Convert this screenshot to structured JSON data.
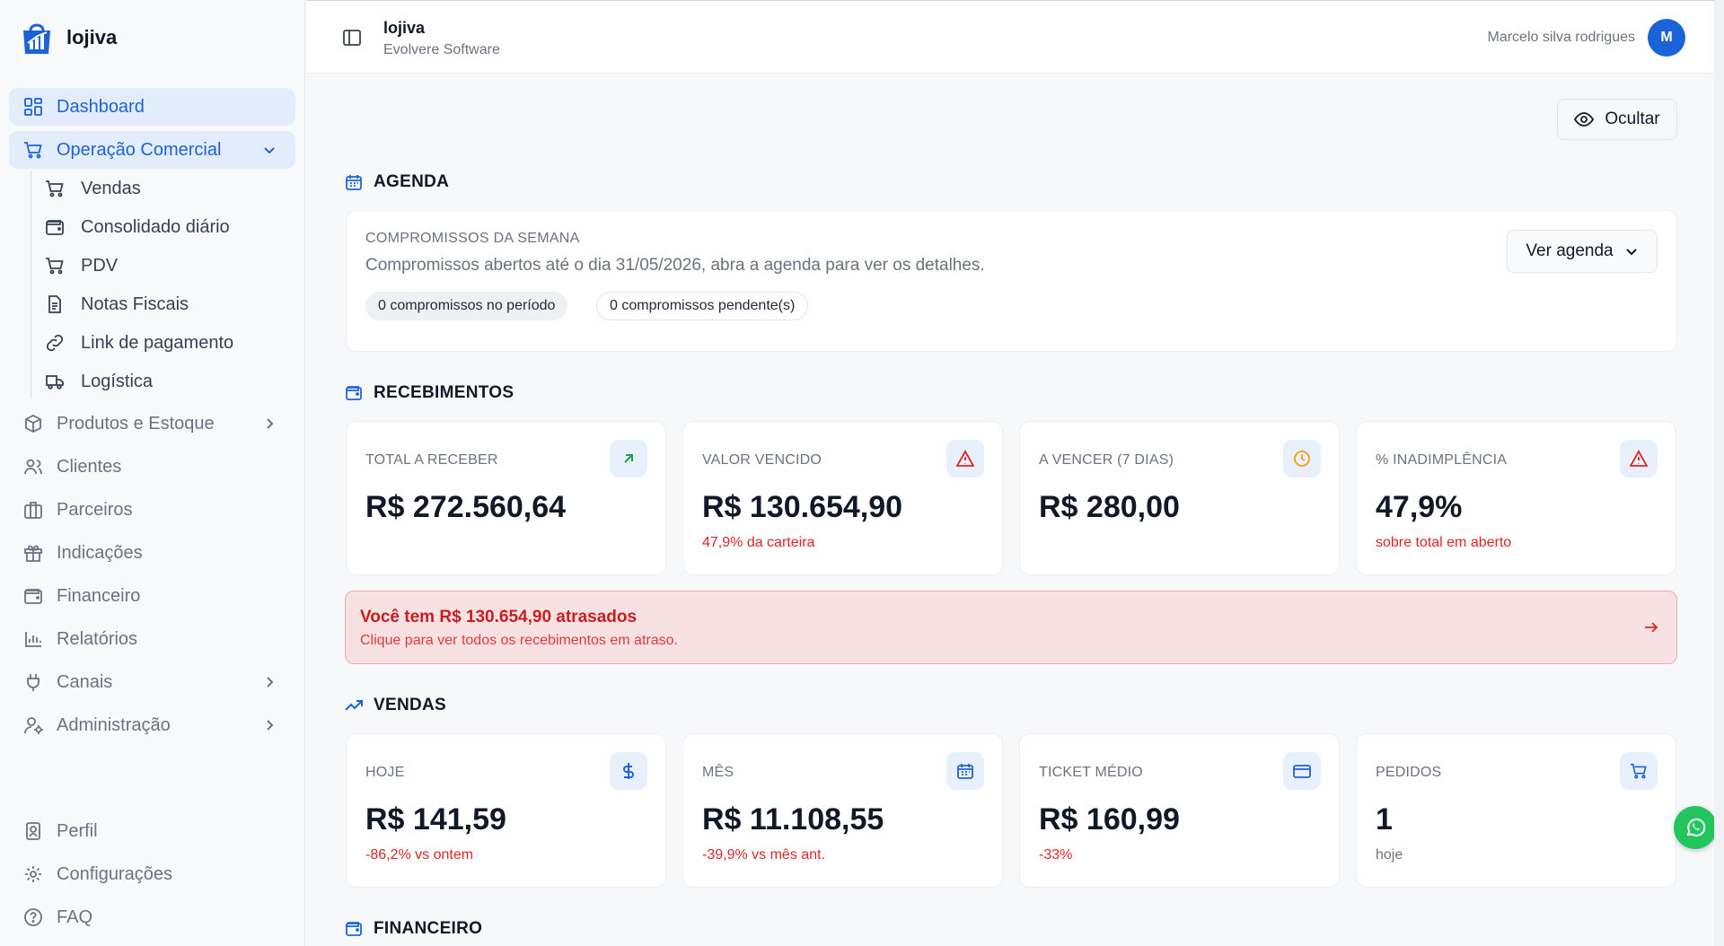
{
  "app": {
    "name": "lojiva"
  },
  "sidebar": {
    "items": [
      {
        "label": "Dashboard",
        "icon": "dashboard-icon"
      },
      {
        "label": "Operação Comercial",
        "icon": "cart-icon"
      },
      {
        "label": "Produtos e Estoque",
        "icon": "box-icon"
      },
      {
        "label": "Clientes",
        "icon": "users-icon"
      },
      {
        "label": "Parceiros",
        "icon": "briefcase-icon"
      },
      {
        "label": "Indicações",
        "icon": "gift-icon"
      },
      {
        "label": "Financeiro",
        "icon": "wallet-icon"
      },
      {
        "label": "Relatórios",
        "icon": "bar-chart-icon"
      },
      {
        "label": "Canais",
        "icon": "plug-icon"
      },
      {
        "label": "Administração",
        "icon": "user-cog-icon"
      }
    ],
    "subitems": [
      {
        "label": "Vendas",
        "icon": "cart-icon"
      },
      {
        "label": "Consolidado diário",
        "icon": "wallet-icon"
      },
      {
        "label": "PDV",
        "icon": "cart-icon"
      },
      {
        "label": "Notas Fiscais",
        "icon": "document-icon"
      },
      {
        "label": "Link de pagamento",
        "icon": "link-icon"
      },
      {
        "label": "Logística",
        "icon": "truck-icon"
      }
    ],
    "bottom": [
      {
        "label": "Perfil",
        "icon": "profile-icon"
      },
      {
        "label": "Configurações",
        "icon": "gear-icon"
      },
      {
        "label": "FAQ",
        "icon": "help-icon"
      }
    ]
  },
  "header": {
    "title": "lojiva",
    "subtitle": "Evolvere Software",
    "user_name": "Marcelo silva rodrigues",
    "avatar_initial": "M"
  },
  "main": {
    "hide_button": "Ocultar",
    "agenda": {
      "title": "AGENDA",
      "kicker": "COMPROMISSOS DA SEMANA",
      "description": "Compromissos abertos até o dia 31/05/2026, abra a agenda para ver os detalhes.",
      "pill_period": "0 compromissos no período",
      "pill_pending": "0 compromissos pendente(s)",
      "button": "Ver agenda"
    },
    "recebimentos": {
      "title": "RECEBIMENTOS",
      "cards": [
        {
          "label": "TOTAL A RECEBER",
          "value": "R$ 272.560,64",
          "sub": "",
          "icon": "arrow-up-right-icon",
          "color": "#16a34a"
        },
        {
          "label": "VALOR VENCIDO",
          "value": "R$ 130.654,90",
          "sub": "47,9% da carteira",
          "icon": "alert-triangle-icon",
          "color": "#dc2626"
        },
        {
          "label": "A VENCER (7 DIAS)",
          "value": "R$ 280,00",
          "sub": "",
          "icon": "clock-icon",
          "color": "#f59e0b"
        },
        {
          "label": "% INADIMPLÊNCIA",
          "value": "47,9%",
          "sub": "sobre total em aberto",
          "icon": "alert-triangle-icon",
          "color": "#dc2626"
        }
      ],
      "alert_title": "Você tem R$ 130.654,90 atrasados",
      "alert_sub": "Clique para ver todos os recebimentos em atraso."
    },
    "vendas": {
      "title": "VENDAS",
      "cards": [
        {
          "label": "HOJE",
          "value": "R$ 141,59",
          "sub": "-86,2% vs ontem",
          "icon": "dollar-icon"
        },
        {
          "label": "MÊS",
          "value": "R$ 11.108,55",
          "sub": "-39,9% vs mês ant.",
          "icon": "calendar-icon"
        },
        {
          "label": "TICKET MÉDIO",
          "value": "R$ 160,99",
          "sub": "-33%",
          "icon": "credit-card-icon"
        },
        {
          "label": "PEDIDOS",
          "value": "1",
          "sub": "hoje",
          "icon": "cart-icon"
        }
      ]
    },
    "financeiro": {
      "title": "FINANCEIRO"
    }
  },
  "colors": {
    "accent": "#1d63d8",
    "danger": "#dc2626",
    "warning": "#f59e0b",
    "success": "#16a34a"
  }
}
